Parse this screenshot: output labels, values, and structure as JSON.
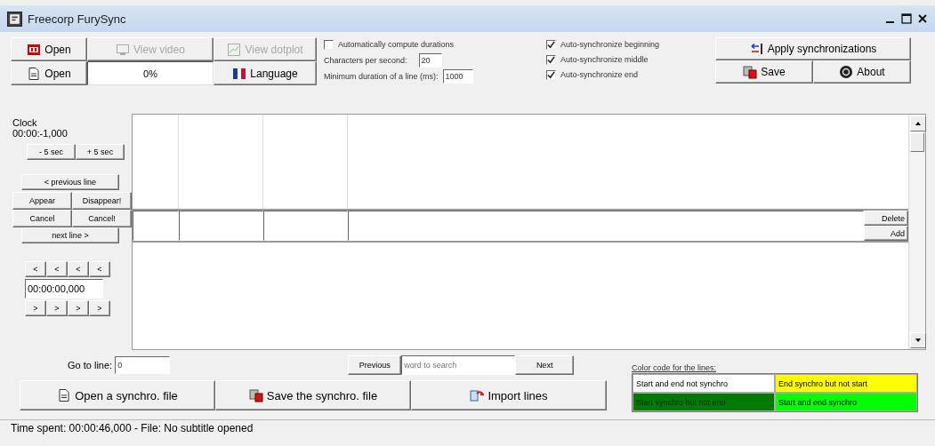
{
  "window": {
    "title": "Freecorp FurySync"
  },
  "toolbar": {
    "buttons": [
      {
        "label": "Open",
        "disabled": false
      },
      {
        "label": "View video",
        "disabled": true
      },
      {
        "label": "View dotplot",
        "disabled": true
      },
      {
        "label": "Open",
        "disabled": false
      },
      {
        "label": "Language",
        "disabled": false
      }
    ],
    "progress": {
      "text": "0%"
    }
  },
  "settings": {
    "auto_compute": {
      "label": "Automatically compute durations",
      "checked": false
    },
    "chars_per_second": {
      "label": "Characters per second:",
      "value": "20"
    },
    "min_duration": {
      "label": "Minimum duration of a line (ms):",
      "value": "1000"
    }
  },
  "sync_options": [
    {
      "label": "Auto-synchronize beginning",
      "checked": true
    },
    {
      "label": "Auto-synchronize middle",
      "checked": true
    },
    {
      "label": "Auto-synchronize end",
      "checked": true
    }
  ],
  "actions": {
    "apply": "Apply synchronizations",
    "save": "Save",
    "about": "About"
  },
  "clock": {
    "label": "Clock",
    "value": "00:00:-1,000",
    "minus": "- 5 sec",
    "plus": "+ 5 sec"
  },
  "navigation": {
    "previous": "< previous line",
    "appear": "Appear",
    "disappear": "Disappear!",
    "cancel": "Cancel",
    "cancel_end": "Cancel!",
    "next": "next line >"
  },
  "time_adjust": {
    "back": [
      "<",
      "<",
      "<",
      "<"
    ],
    "value": "00:00:00,000",
    "forward": [
      ">",
      ">",
      ">",
      ">"
    ]
  },
  "line_editor": {
    "delete": "Delete",
    "add": "Add"
  },
  "goto": {
    "label": "Go to line:",
    "value": "0"
  },
  "search": {
    "previous": "Previous",
    "placeholder": "word to search",
    "next": "Next"
  },
  "color_code": {
    "title": "Color code for the lines:",
    "items": [
      {
        "label": "Start and end not synchro",
        "color": "#ffffff"
      },
      {
        "label": "End synchro but not start",
        "color": "#ffff00"
      },
      {
        "label": "Start synchro but not end",
        "color": "#007a00"
      },
      {
        "label": "Start and end synchro",
        "color": "#00ff00"
      }
    ]
  },
  "file_buttons": [
    "Open a synchro. file",
    "Save the synchro. file",
    "Import lines"
  ],
  "status_bar": "Time spent: 00:00:46,000 - File: No subtitle opened"
}
